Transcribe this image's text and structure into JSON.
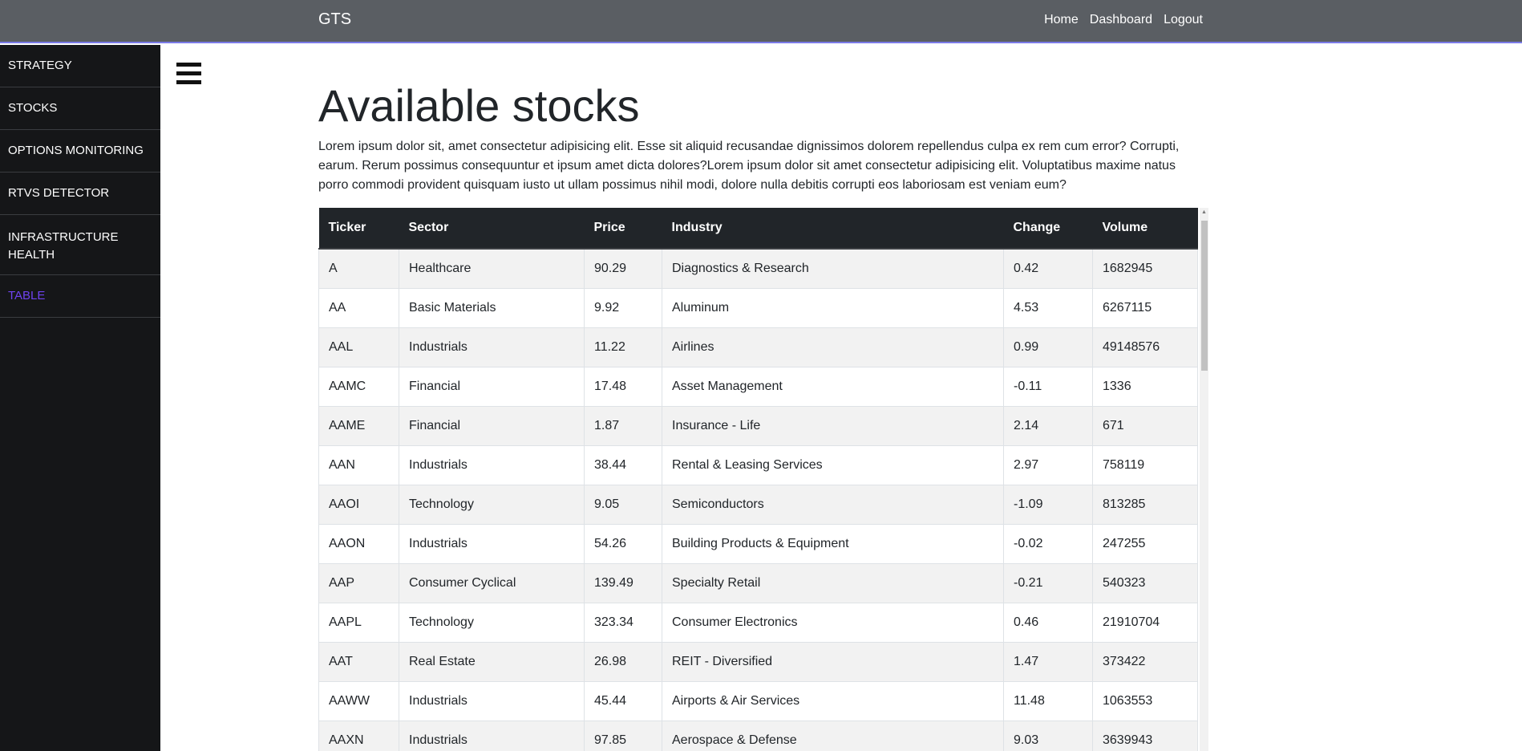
{
  "navbar": {
    "brand": "GTS",
    "links": [
      "Home",
      "Dashboard",
      "Logout"
    ]
  },
  "sidebar": {
    "items": [
      {
        "label": "STRATEGY",
        "active": false
      },
      {
        "label": "STOCKS",
        "active": false
      },
      {
        "label": "OPTIONS MONITORING",
        "active": false
      },
      {
        "label": "RTVS DETECTOR",
        "active": false
      },
      {
        "label": "INFRASTRUCTURE HEALTH",
        "active": false
      },
      {
        "label": "TABLE",
        "active": true
      }
    ]
  },
  "main": {
    "title": "Available stocks",
    "description": "Lorem ipsum dolor sit, amet consectetur adipisicing elit. Esse sit aliquid recusandae dignissimos dolorem repellendus culpa ex rem cum error? Corrupti, earum. Rerum possimus consequuntur et ipsum amet dicta dolores?Lorem ipsum dolor sit amet consectetur adipisicing elit. Voluptatibus maxime natus porro commodi provident quisquam iusto ut ullam possimus nihil modi, dolore nulla debitis corrupti eos laboriosam est veniam eum?",
    "table": {
      "headers": [
        "Ticker",
        "Sector",
        "Price",
        "Industry",
        "Change",
        "Volume"
      ],
      "rows": [
        [
          "A",
          "Healthcare",
          "90.29",
          "Diagnostics & Research",
          "0.42",
          "1682945"
        ],
        [
          "AA",
          "Basic Materials",
          "9.92",
          "Aluminum",
          "4.53",
          "6267115"
        ],
        [
          "AAL",
          "Industrials",
          "11.22",
          "Airlines",
          "0.99",
          "49148576"
        ],
        [
          "AAMC",
          "Financial",
          "17.48",
          "Asset Management",
          "-0.11",
          "1336"
        ],
        [
          "AAME",
          "Financial",
          "1.87",
          "Insurance - Life",
          "2.14",
          "671"
        ],
        [
          "AAN",
          "Industrials",
          "38.44",
          "Rental & Leasing Services",
          "2.97",
          "758119"
        ],
        [
          "AAOI",
          "Technology",
          "9.05",
          "Semiconductors",
          "-1.09",
          "813285"
        ],
        [
          "AAON",
          "Industrials",
          "54.26",
          "Building Products & Equipment",
          "-0.02",
          "247255"
        ],
        [
          "AAP",
          "Consumer Cyclical",
          "139.49",
          "Specialty Retail",
          "-0.21",
          "540323"
        ],
        [
          "AAPL",
          "Technology",
          "323.34",
          "Consumer Electronics",
          "0.46",
          "21910704"
        ],
        [
          "AAT",
          "Real Estate",
          "26.98",
          "REIT - Diversified",
          "1.47",
          "373422"
        ],
        [
          "AAWW",
          "Industrials",
          "45.44",
          "Airports & Air Services",
          "11.48",
          "1063553"
        ],
        [
          "AAXN",
          "Industrials",
          "97.85",
          "Aerospace & Defense",
          "9.03",
          "3639943"
        ]
      ]
    }
  },
  "icons": {
    "menu": "hamburger-menu-icon"
  },
  "colors": {
    "navbar_bg": "#5a5e63",
    "sidebar_bg": "#151618",
    "active_item": "#6f42f0",
    "table_header_bg": "#212529"
  }
}
